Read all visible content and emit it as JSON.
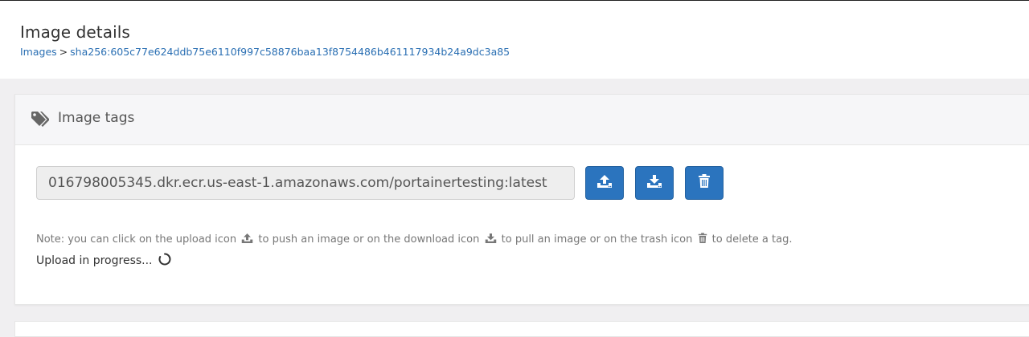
{
  "header": {
    "title": "Image details",
    "breadcrumb": {
      "parent": "Images",
      "separator": ">",
      "current": "sha256:605c77e624ddb75e6110f997c58876baa13f8754486b461117934b24a9dc3a85"
    }
  },
  "widget": {
    "icon": "tags-icon",
    "title": "Image tags",
    "tag_value": "016798005345.dkr.ecr.us-east-1.amazonaws.com/portainertesting:latest",
    "buttons": [
      {
        "name": "push-button",
        "icon": "upload-icon"
      },
      {
        "name": "pull-button",
        "icon": "download-icon"
      },
      {
        "name": "delete-button",
        "icon": "trash-icon"
      }
    ],
    "note": {
      "part1": "Note: you can click on the upload icon",
      "part2": "to push an image or on the download icon",
      "part3": "to pull an image or on the trash icon",
      "part4": "to delete a tag."
    },
    "progress_text": "Upload in progress..."
  },
  "colors": {
    "accent": "#2b74be",
    "link": "#2a6fb3",
    "background": "#f0eff1"
  }
}
